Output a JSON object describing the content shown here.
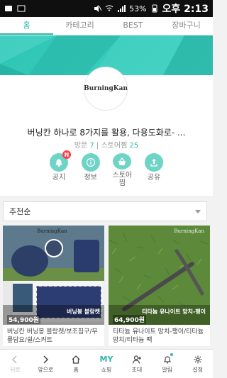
{
  "statusbar": {
    "battery_pct": "53%",
    "time": "오후 2:13"
  },
  "tabs": [
    {
      "label": "홈",
      "active": true
    },
    {
      "label": "카테고리"
    },
    {
      "label": "BEST"
    },
    {
      "label": "장바구니"
    }
  ],
  "store": {
    "logo_text": "BurningKan",
    "name": "버닝칸 하나로 8가지를 활용, 다용도화로- ...",
    "visits_label": "방문",
    "visits": "7",
    "fans_label": "스토어찜",
    "fans": "25"
  },
  "actions": [
    {
      "label": "공지",
      "badge": "N",
      "icon": "bell-icon"
    },
    {
      "label": "정보",
      "icon": "info-icon"
    },
    {
      "label": "스토어\n찜",
      "icon": "basket-icon"
    },
    {
      "label": "공유",
      "icon": "share-icon"
    }
  ],
  "sort": {
    "selected": "추천순"
  },
  "products": [
    {
      "brand": "BurningKan",
      "caption": "버닝봉 블랑켓",
      "price": "54,900원",
      "title": "버닝칸 버닝봉 블랑켓/보조침구/무릎담요/쉴/스커트"
    },
    {
      "brand": "BurningKan",
      "caption": "티타늄 유나이트 망치-팽이",
      "price": "64,900원",
      "title": "티타늄 유나이트 망치-팽이/티타늄 망치/티타늄 팩"
    }
  ],
  "bottomnav": [
    {
      "label": "뒤로",
      "icon": "back-icon",
      "disabled": true
    },
    {
      "label": "앞으로",
      "icon": "forward-icon"
    },
    {
      "label": "홈",
      "icon": "home-icon"
    },
    {
      "label": "쇼핑",
      "icon": "my-shopping-icon",
      "top_text": "MY"
    },
    {
      "label": "초대",
      "icon": "invite-icon"
    },
    {
      "label": "알림",
      "icon": "alarm-icon"
    },
    {
      "label": "설정",
      "icon": "settings-icon"
    }
  ],
  "colors": {
    "accent": "#2fb7a8",
    "hero": "#2ec4b4",
    "badge": "#ff3b45"
  }
}
